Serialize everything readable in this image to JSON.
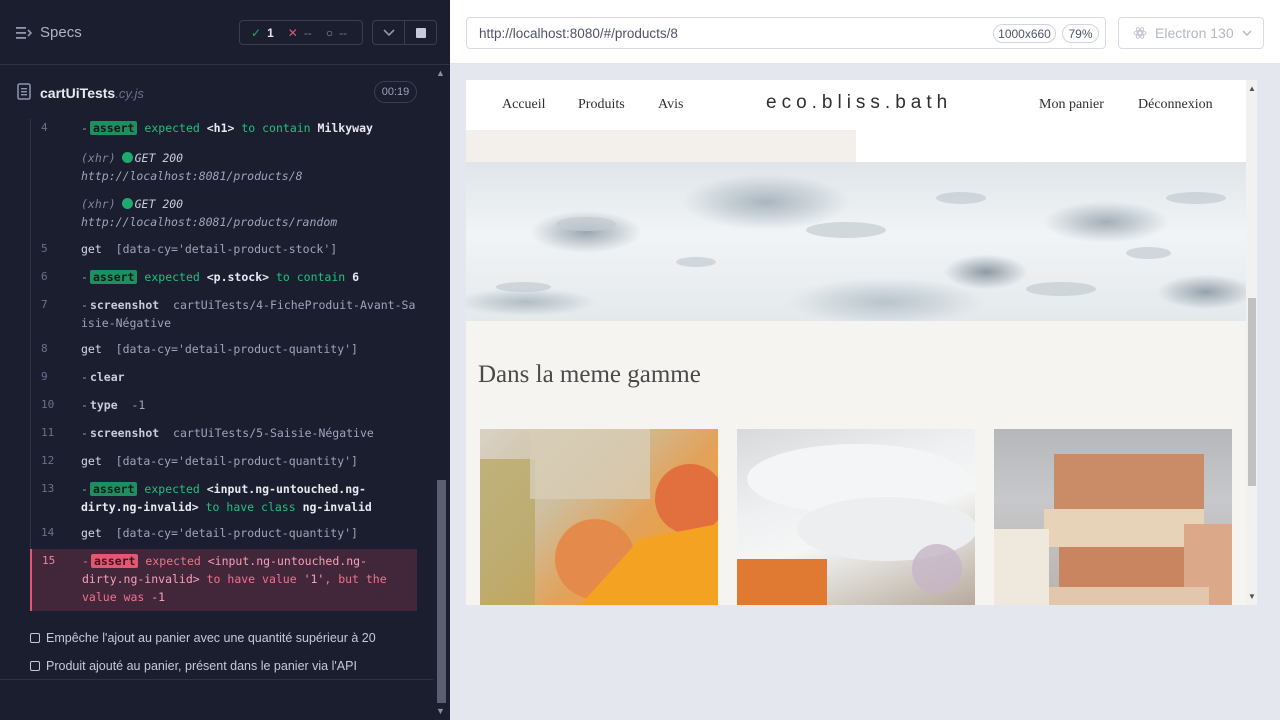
{
  "reporter": {
    "specs_label": "Specs",
    "stats": {
      "passed": "1",
      "failed": "--",
      "pending": "--"
    },
    "spec_file": {
      "name": "cartUiTests",
      "ext": ".cy.js",
      "duration": "00:19"
    },
    "commands": [
      {
        "line": "4",
        "name": "assert",
        "text": "expected <h1> to contain Milkyway"
      },
      {
        "line": "",
        "name": "(xhr)",
        "method_status": "GET 200",
        "url": "http://localhost:8081/products/8"
      },
      {
        "line": "",
        "name": "(xhr)",
        "method_status": "GET 200",
        "url": "http://localhost:8081/products/random"
      },
      {
        "line": "5",
        "name": "get",
        "text": "[data-cy='detail-product-stock']"
      },
      {
        "line": "6",
        "name": "assert",
        "text": "expected <p.stock> to contain 6"
      },
      {
        "line": "7",
        "name": "screenshot",
        "text": "cartUiTests/4-FicheProduit-Avant-Saisie-Négative"
      },
      {
        "line": "8",
        "name": "get",
        "text": "[data-cy='detail-product-quantity']"
      },
      {
        "line": "9",
        "name": "clear",
        "text": ""
      },
      {
        "line": "10",
        "name": "type",
        "text": "-1"
      },
      {
        "line": "11",
        "name": "screenshot",
        "text": "cartUiTests/5-Saisie-Négative"
      },
      {
        "line": "12",
        "name": "get",
        "text": "[data-cy='detail-product-quantity']"
      },
      {
        "line": "13",
        "name": "assert",
        "text": "expected <input.ng-untouched.ng-dirty.ng-invalid> to have class ng-invalid"
      },
      {
        "line": "14",
        "name": "get",
        "text": "[data-cy='detail-product-quantity']"
      },
      {
        "line": "15",
        "name": "assert",
        "text": "expected <input.ng-untouched.ng-dirty.ng-invalid> to have value '1', but the value was -1",
        "state": "failed"
      }
    ],
    "pending_tests": [
      "Empêche l'ajout au panier avec une quantité supérieur à 20",
      "Produit ajouté au panier, présent dans le panier via l'API"
    ]
  },
  "aut": {
    "url": "http://localhost:8080/#/products/8",
    "viewport": "1000x660",
    "zoom": "79%",
    "browser": "Electron 130"
  },
  "site": {
    "nav_left": [
      "Accueil",
      "Produits",
      "Avis"
    ],
    "logo": "eco.bliss.bath",
    "nav_right": [
      "Mon panier",
      "Déconnexion"
    ],
    "section_title": "Dans la meme gamme"
  },
  "colors": {
    "reporter_bg": "#1b1e2e",
    "pass": "#1fa971",
    "fail": "#e45770",
    "site_bg": "#f6f4f0"
  }
}
